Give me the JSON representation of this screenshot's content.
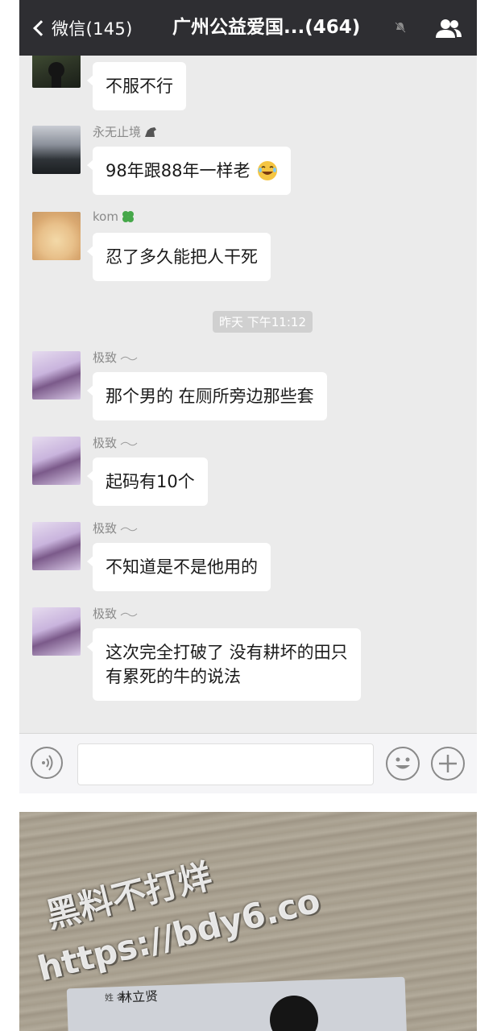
{
  "header": {
    "back_label": "微信(145)",
    "title": "广州公益爱国...(464)"
  },
  "colors": {
    "header_bg": "#2e2e32",
    "chat_bg": "#ebebeb",
    "bubble_bg": "#ffffff",
    "name_text": "#8a8a8a"
  },
  "messages": [
    {
      "sender": "",
      "text": "不服不行",
      "avatar": "dark-landscape-photo"
    },
    {
      "sender": "永无止境",
      "sender_icon": "horse-emoji",
      "text": "98年跟88年一样老",
      "emoji": "laughing-tears-emoji",
      "avatar": "mountain-photo"
    },
    {
      "sender": "kom",
      "sender_icon": "clover-emoji",
      "text": "忍了多久能把人干死",
      "avatar": "bread-photo"
    },
    {
      "sender": "极致",
      "sender_icon": "wave-line",
      "text": "那个男的 在厕所旁边那些套",
      "avatar": "girl-photo"
    },
    {
      "sender": "极致",
      "sender_icon": "wave-line",
      "text": "起码有10个",
      "avatar": "girl-photo"
    },
    {
      "sender": "极致",
      "sender_icon": "wave-line",
      "text": "不知道是不是他用的",
      "avatar": "girl-photo"
    },
    {
      "sender": "极致",
      "sender_icon": "wave-line",
      "text_line1": "这次完全打破了 没有耕坏的田只",
      "text_line2": "有累死的牛的说法",
      "avatar": "girl-photo"
    }
  ],
  "timestamp": "昨天 下午11:12",
  "photo": {
    "card_label": "姓 名",
    "card_name": "林立贤"
  },
  "watermark": {
    "line1": "黑料不打烊",
    "line2": "https://bdy6.co"
  }
}
